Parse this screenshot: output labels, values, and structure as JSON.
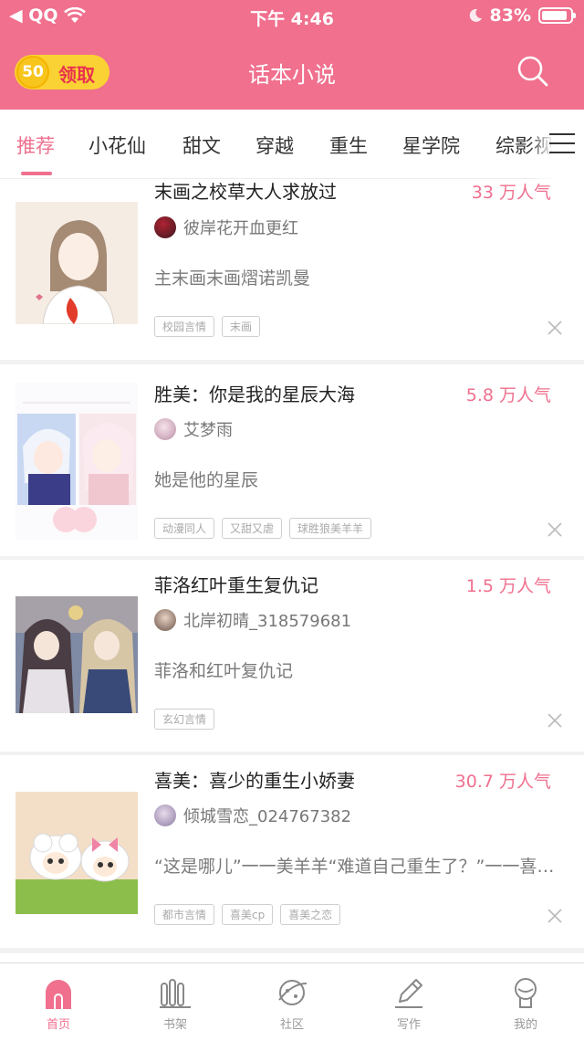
{
  "status_bar": {
    "carrier": "◀ QQ",
    "time": "下午 4:46",
    "battery": "83%"
  },
  "header": {
    "reward_coin": "50",
    "reward_label": "领取",
    "title": "话本小说"
  },
  "tabs": [
    {
      "label": "推荐",
      "active": true
    },
    {
      "label": "小花仙"
    },
    {
      "label": "甜文"
    },
    {
      "label": "穿越"
    },
    {
      "label": "重生"
    },
    {
      "label": "星学院"
    },
    {
      "label": "综影视"
    }
  ],
  "books": [
    {
      "title": "末画之校草大人求放过",
      "popularity": "33 万人气",
      "author": "彼岸花开血更红",
      "summary": "主末画末画熠诺凯曼",
      "tags": [
        "校园言情",
        "末画"
      ]
    },
    {
      "title": "胜美：你是我的星辰大海",
      "popularity": "5.8 万人气",
      "author": "艾梦雨",
      "summary": "她是他的星辰",
      "tags": [
        "动漫同人",
        "又甜又虐",
        "球胜狼美羊羊"
      ]
    },
    {
      "title": "菲洛红叶重生复仇记",
      "popularity": "1.5 万人气",
      "author": "北岸初晴_318579681",
      "summary": "菲洛和红叶复仇记",
      "tags": [
        "玄幻言情"
      ]
    },
    {
      "title": "喜美：喜少的重生小娇妻",
      "popularity": "30.7 万人气",
      "author": "倾城雪恋_024767382",
      "summary": "“这是哪儿”一一美羊羊“难道自己重生了？”一一喜羊羊“我记得我……",
      "tags": [
        "都市言情",
        "喜美cp",
        "喜美之恋"
      ]
    }
  ],
  "bottom_nav": [
    {
      "label": "首页",
      "icon": "home-icon",
      "active": true
    },
    {
      "label": "书架",
      "icon": "bookshelf-icon"
    },
    {
      "label": "社区",
      "icon": "community-icon"
    },
    {
      "label": "写作",
      "icon": "write-icon"
    },
    {
      "label": "我的",
      "icon": "profile-icon"
    }
  ],
  "colors": {
    "brand": "#f0708e",
    "reward_bg": "#fbd233",
    "reward_text": "#e8324f"
  }
}
